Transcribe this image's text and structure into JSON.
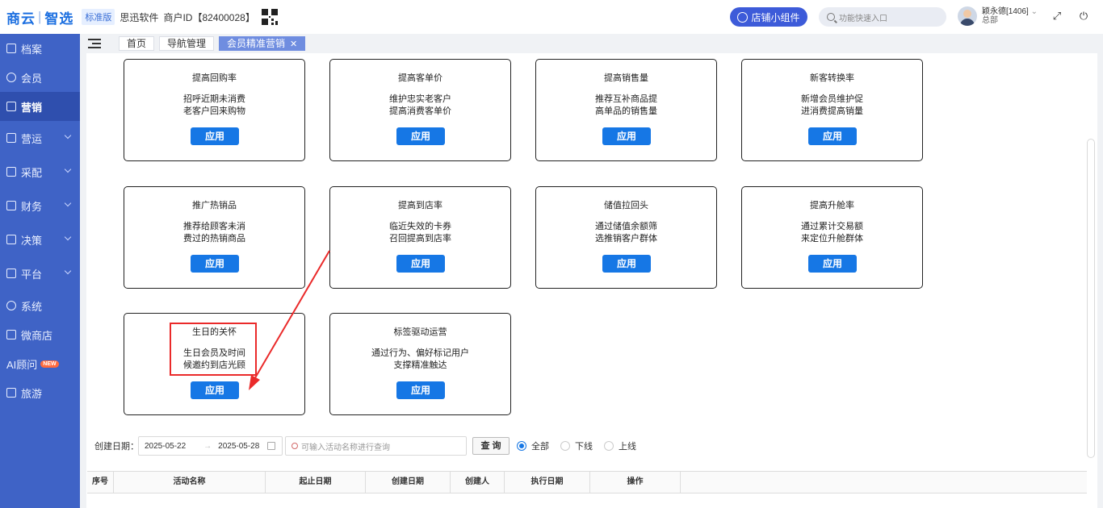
{
  "header": {
    "logo_left": "商云",
    "logo_right": "智选",
    "edition": "标准版",
    "company": "思迅软件",
    "merchant_id": "商户ID【82400028】",
    "widget_button": "店铺小组件",
    "search_placeholder": "功能快速入口",
    "user_name": "颖永德[1406]",
    "user_role": "总部"
  },
  "sidebar": {
    "items": [
      {
        "label": "档案"
      },
      {
        "label": "会员"
      },
      {
        "label": "营销"
      },
      {
        "label": "营运"
      },
      {
        "label": "采配"
      },
      {
        "label": "财务"
      },
      {
        "label": "决策"
      },
      {
        "label": "平台"
      },
      {
        "label": "系统"
      },
      {
        "label": "微商店"
      },
      {
        "label": "AI顾问",
        "badge": "NEW"
      },
      {
        "label": "旅游"
      }
    ]
  },
  "tabs": [
    {
      "label": "首页"
    },
    {
      "label": "导航管理"
    },
    {
      "label": "会员精准营销"
    }
  ],
  "cards": [
    {
      "title": "提高回购率",
      "line1": "招呼近期未消费",
      "line2": "老客户回来购物",
      "button": "应用"
    },
    {
      "title": "提高客单价",
      "line1": "维护忠实老客户",
      "line2": "提高消费客单价",
      "button": "应用"
    },
    {
      "title": "提高销售量",
      "line1": "推荐互补商品提",
      "line2": "高单品的销售量",
      "button": "应用"
    },
    {
      "title": "新客转换率",
      "line1": "新增会员维护促",
      "line2": "进消费提高销量",
      "button": "应用"
    },
    {
      "title": "推广热销品",
      "line1": "推荐给顾客未消",
      "line2": "费过的热销商品",
      "button": "应用"
    },
    {
      "title": "提高到店率",
      "line1": "临近失效的卡券",
      "line2": "召回提高到店率",
      "button": "应用"
    },
    {
      "title": "储值拉回头",
      "line1": "通过储值余额筛",
      "line2": "选推销客户群体",
      "button": "应用"
    },
    {
      "title": "提高升舱率",
      "line1": "通过累计交易额",
      "line2": "来定位升舱群体",
      "button": "应用"
    },
    {
      "title": "生日的关怀",
      "line1": "生日会员及时间",
      "line2": "候邀约到店光顾",
      "button": "应用"
    },
    {
      "title": "标签驱动运营",
      "line1": "通过行为、偏好标记用户",
      "line2": "支撑精准触达",
      "button": "应用"
    }
  ],
  "filter": {
    "label": "创建日期：",
    "start_date": "2025-05-22",
    "end_date": "2025-05-28",
    "search_placeholder": "可输入活动名称进行查询",
    "query_button": "查 询",
    "radio_all": "全部",
    "radio_offline": "下线",
    "radio_online": "上线"
  },
  "table": {
    "columns": [
      "序号",
      "活动名称",
      "起止日期",
      "创建日期",
      "创建人",
      "执行日期",
      "操作"
    ]
  },
  "colors": {
    "sidebar": "#3f63c6",
    "primary_button": "#1677e5",
    "annotation": "#ea2a2a"
  }
}
